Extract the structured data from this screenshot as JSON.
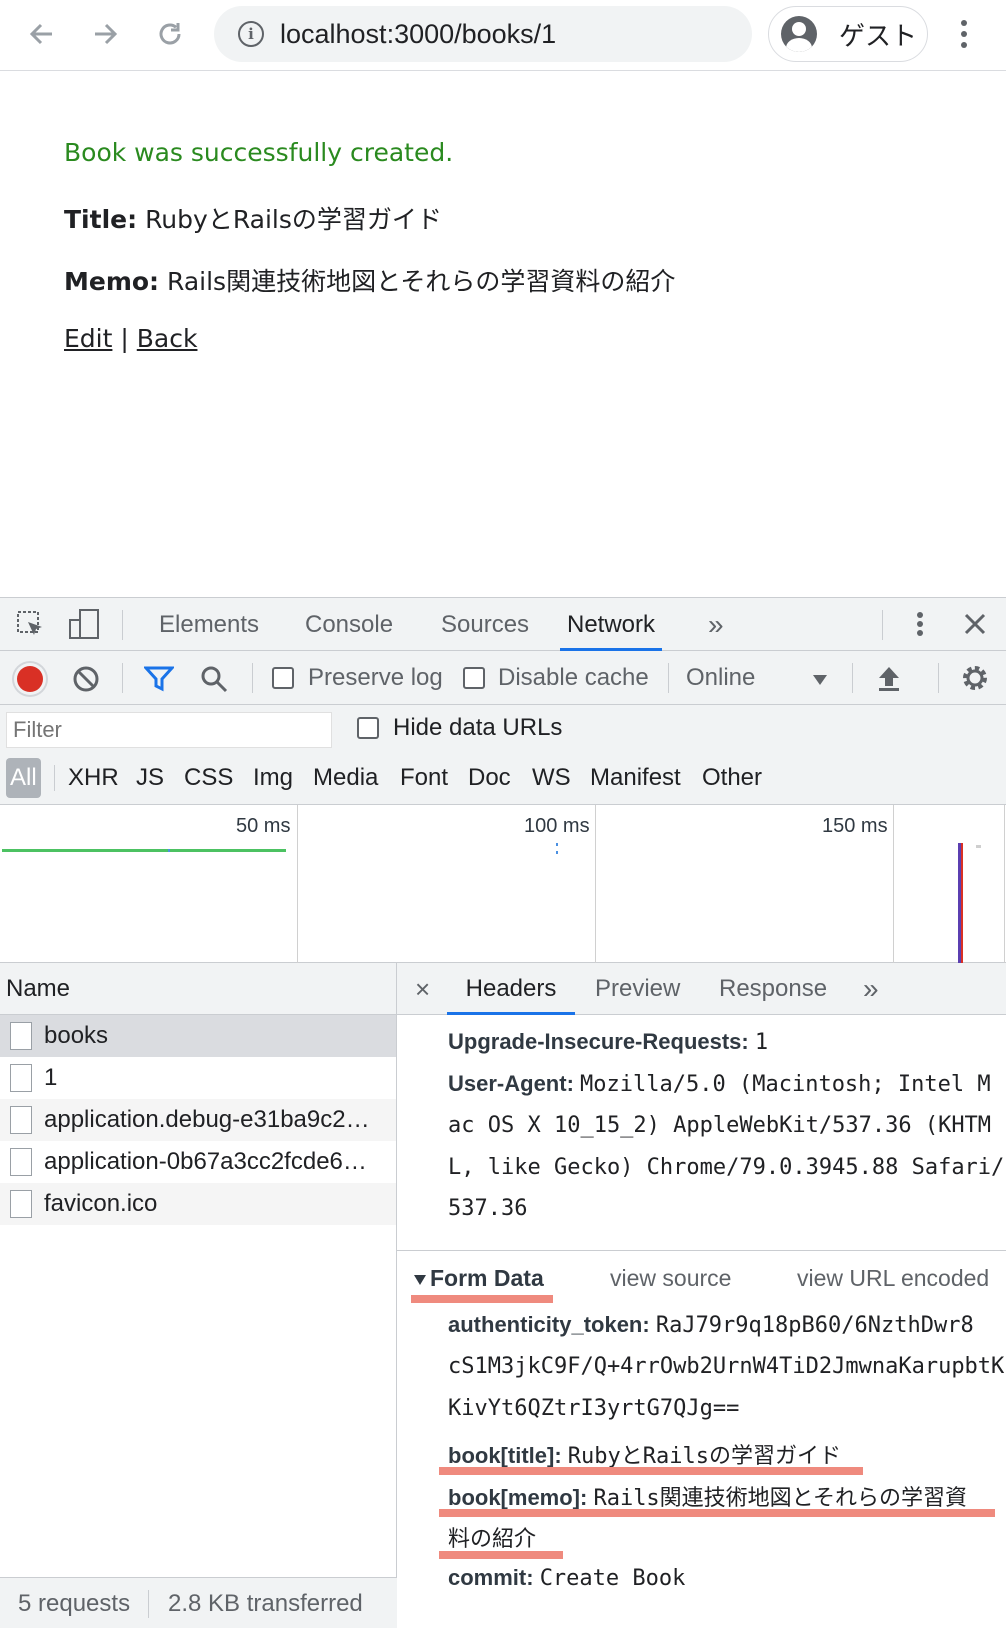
{
  "browser": {
    "url": "localhost:3000/books/1",
    "profile_label": "ゲスト"
  },
  "page": {
    "notice": "Book was successfully created.",
    "title_label": "Title:",
    "title_value": "RubyとRailsの学習ガイド",
    "memo_label": "Memo:",
    "memo_value": "Rails関連技術地図とそれらの学習資料の紹介",
    "edit_link": "Edit",
    "separator": "|",
    "back_link": "Back"
  },
  "devtools": {
    "tabs": [
      "Elements",
      "Console",
      "Sources",
      "Network"
    ],
    "more_tabs": "»",
    "toolbar": {
      "preserve_log": "Preserve log",
      "disable_cache": "Disable cache",
      "throttle": "Online"
    },
    "filter": {
      "placeholder": "Filter",
      "hide_data_urls": "Hide data URLs",
      "types": [
        "All",
        "XHR",
        "JS",
        "CSS",
        "Img",
        "Media",
        "Font",
        "Doc",
        "WS",
        "Manifest",
        "Other"
      ]
    },
    "timeline": {
      "ticks": [
        "50 ms",
        "100 ms",
        "150 ms"
      ]
    },
    "requests": {
      "header": "Name",
      "items": [
        "books",
        "1",
        "application.debug-e31ba9c2…",
        "application-0b67a3cc2fcde6…",
        "favicon.ico"
      ],
      "summary_requests": "5 requests",
      "summary_transferred": "2.8 KB transferred"
    },
    "details": {
      "close": "×",
      "tabs": [
        "Headers",
        "Preview",
        "Response"
      ],
      "more": "»",
      "upgrade_key": "Upgrade-Insecure-Requests:",
      "upgrade_val": "1",
      "ua_key": "User-Agent:",
      "ua_line1": "Mozilla/5.0 (Macintosh; Intel M",
      "ua_line2": "ac OS X 10_15_2) AppleWebKit/537.36 (KHTM",
      "ua_line3": "L, like Gecko) Chrome/79.0.3945.88 Safari/",
      "ua_line4": "537.36",
      "form_data_title": "Form Data",
      "view_source": "view source",
      "view_url_encoded": "view URL encoded",
      "token_key": "authenticity_token:",
      "token_line1": "RaJ79r9q18pB60/6NzthDwr8",
      "token_line2": "cS1M3jkC9F/Q+4rrOwb2UrnW4TiD2JmwnaKarupbtK",
      "token_line3": "KivYt6QZtrI3yrtG7QJg==",
      "book_title_key": "book[title]:",
      "book_title_val": "RubyとRailsの学習ガイド",
      "book_memo_key": "book[memo]:",
      "book_memo_line1": "Rails関連技術地図とそれらの学習資",
      "book_memo_line2": "料の紹介",
      "commit_key": "commit:",
      "commit_val": "Create Book"
    }
  },
  "colors": {
    "notice_green": "#2a8a1f",
    "highlight_salmon": "#ef8a7e",
    "active_tab_blue": "#1a73e8",
    "record_red": "#d93025"
  }
}
